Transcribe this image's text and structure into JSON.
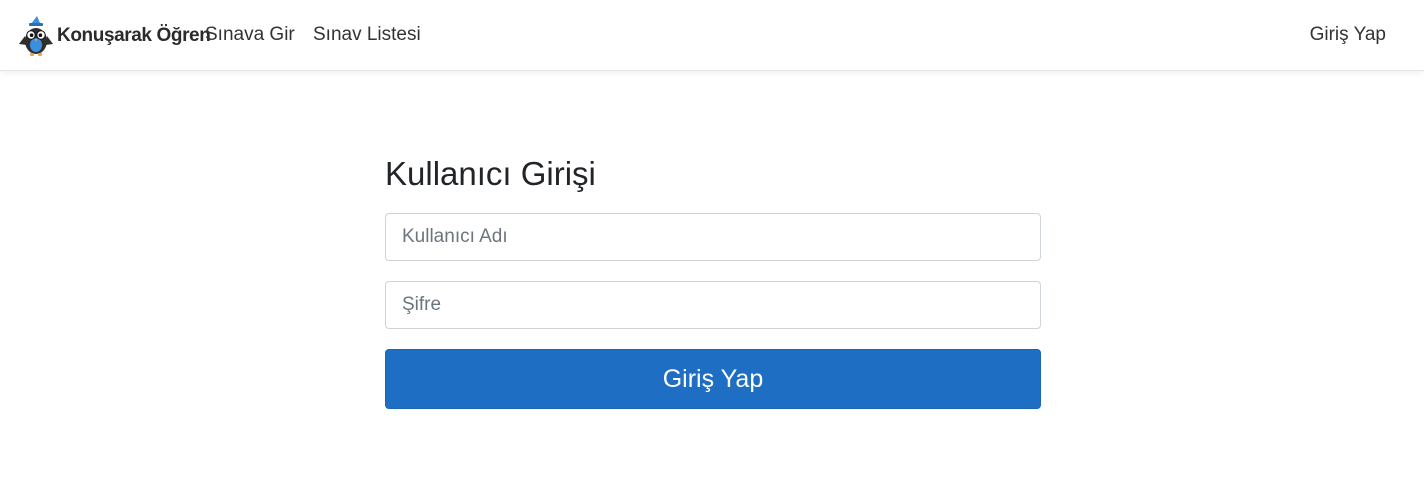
{
  "navbar": {
    "brand_name": "Konuşarak Öğren",
    "links": {
      "take_exam": "Sınava Gir",
      "exam_list": "Sınav Listesi"
    },
    "login_link": "Giriş Yap"
  },
  "login_form": {
    "title": "Kullanıcı Girişi",
    "username": {
      "value": "",
      "placeholder": "Kullanıcı Adı"
    },
    "password": {
      "value": "",
      "placeholder": "Şifre"
    },
    "submit_label": "Giriş Yap"
  },
  "colors": {
    "primary_button": "#1e6fc4",
    "navbar_bg": "#ffffff",
    "brand_blue": "#3a8fde"
  },
  "icons": {
    "brand_logo": "owl-mascot-icon"
  }
}
